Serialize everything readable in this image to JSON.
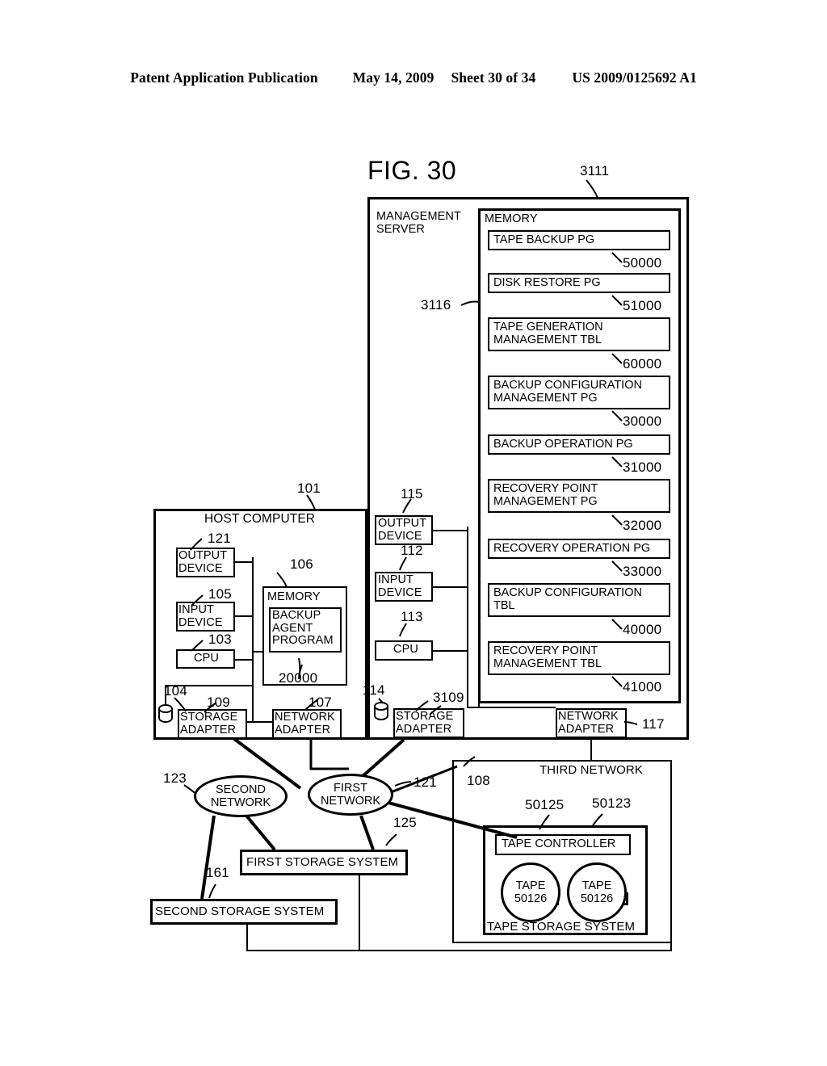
{
  "header": {
    "publication": "Patent Application Publication",
    "date": "May 14, 2009",
    "sheet": "Sheet 30 of 34",
    "patent_number": "US 2009/0125692 A1"
  },
  "figure": {
    "title": "FIG. 30"
  },
  "management_server": {
    "ref": "3111",
    "label": "MANAGEMENT\nSERVER",
    "memory_ref": "3116",
    "memory": {
      "label": "MEMORY",
      "items": [
        {
          "label": "TAPE BACKUP PG",
          "ref": "50000"
        },
        {
          "label": "DISK RESTORE PG",
          "ref": "51000"
        },
        {
          "label": "TAPE GENERATION\nMANAGEMENT TBL",
          "ref": "60000"
        },
        {
          "label": "BACKUP CONFIGURATION\nMANAGEMENT PG",
          "ref": "30000"
        },
        {
          "label": "BACKUP OPERATION PG",
          "ref": "31000"
        },
        {
          "label": "RECOVERY POINT\nMANAGEMENT PG",
          "ref": "32000"
        },
        {
          "label": "RECOVERY OPERATION PG",
          "ref": "33000"
        },
        {
          "label": "BACKUP CONFIGURATION\nTBL",
          "ref": "40000"
        },
        {
          "label": "RECOVERY POINT\nMANAGEMENT TBL",
          "ref": "41000"
        }
      ]
    },
    "devices": [
      {
        "label": "OUTPUT\nDEVICE",
        "ref": "115"
      },
      {
        "label": "INPUT\nDEVICE",
        "ref": "112"
      },
      {
        "label": "CPU",
        "ref": "113"
      },
      {
        "label": "STORAGE\nADAPTER",
        "ref": "3109"
      },
      {
        "label": "NETWORK\nADAPTER",
        "ref": "117"
      }
    ],
    "disk_ref": "114"
  },
  "host_computer": {
    "ref": "101",
    "label": "HOST COMPUTER",
    "memory": {
      "label": "MEMORY",
      "ref": "106",
      "program_label": "BACKUP\nAGENT\nPROGRAM",
      "program_ref": "20000"
    },
    "devices": [
      {
        "label": "OUTPUT\nDEVICE",
        "ref": "121"
      },
      {
        "label": "INPUT\nDEVICE",
        "ref": "105"
      },
      {
        "label": "CPU",
        "ref": "103"
      },
      {
        "label": "STORAGE\nADAPTER",
        "ref": "109"
      },
      {
        "label": "NETWORK\nADAPTER",
        "ref": "107"
      }
    ],
    "disk_ref": "104"
  },
  "networks": {
    "first": {
      "label": "FIRST\nNETWORK",
      "ref": "121"
    },
    "second": {
      "label": "SECOND\nNETWORK",
      "ref": "123"
    },
    "third": {
      "label": "THIRD NETWORK",
      "ref": "108"
    }
  },
  "storage": {
    "first_storage_system": {
      "label": "FIRST STORAGE SYSTEM",
      "ref": "125"
    },
    "second_storage_system": {
      "label": "SECOND STORAGE SYSTEM",
      "ref": "161"
    }
  },
  "tape_storage_system": {
    "label": "TAPE STORAGE SYSTEM",
    "ref": "50123",
    "controller": {
      "label": "TAPE CONTROLLER",
      "ref": "50125"
    },
    "tapes": [
      {
        "label": "TAPE\n50126"
      },
      {
        "label": "TAPE\n50126"
      }
    ]
  }
}
